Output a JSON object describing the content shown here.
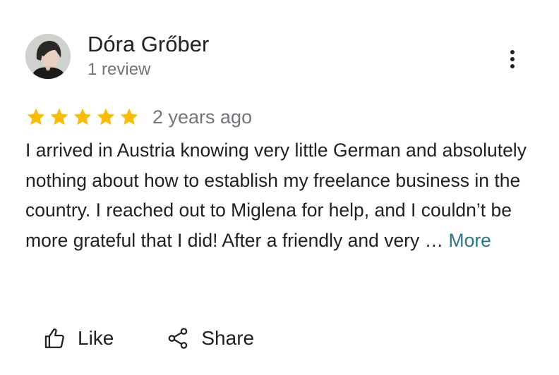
{
  "review": {
    "author": {
      "name": "Dóra Grőber",
      "review_count": "1 review",
      "avatar_icon": "profile-photo"
    },
    "menu_icon": "more-vert-icon",
    "rating": 5,
    "rating_max": 5,
    "star_color": "#fbbc04",
    "time": "2 years ago",
    "text": "I arrived in Austria knowing very little German and absolutely nothing about how to establish my freelance business in the country. I reached out to Miglena for help, and I couldn’t be more grateful that I did! After a friendly and very … ",
    "more_label": "More",
    "more_color": "#2a7489"
  },
  "actions": {
    "like_label": "Like",
    "like_icon": "thumb-up-icon",
    "share_label": "Share",
    "share_icon": "share-icon"
  }
}
